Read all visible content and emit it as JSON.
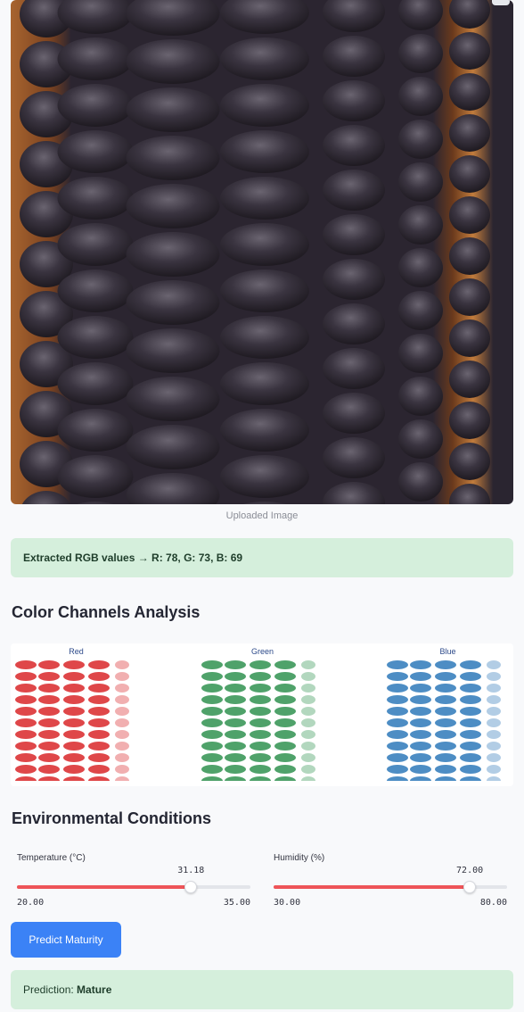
{
  "image": {
    "caption": "Uploaded Image",
    "description_icon": "corn-photo"
  },
  "rgb_alert": {
    "prefix": "Extracted RGB values → R: 78, G: 73, B: 69",
    "r": 78,
    "g": 73,
    "b": 69
  },
  "channels_section": {
    "title": "Color Channels Analysis",
    "channels": [
      {
        "label": "Red",
        "color": "#d7191c"
      },
      {
        "label": "Green",
        "color": "#238b45"
      },
      {
        "label": "Blue",
        "color": "#2171b5"
      }
    ]
  },
  "env_section": {
    "title": "Environmental Conditions",
    "sliders": [
      {
        "label": "Temperature (°C)",
        "value": "31.18",
        "min": "20.00",
        "max": "35.00",
        "fraction": 0.7453
      },
      {
        "label": "Humidity (%)",
        "value": "72.00",
        "min": "30.00",
        "max": "80.00",
        "fraction": 0.84
      }
    ]
  },
  "predict_button": {
    "label": "Predict Maturity"
  },
  "prediction": {
    "prefix": "Prediction: ",
    "value": "Mature"
  },
  "colors": {
    "success_bg": "#d5efdc",
    "slider_fill": "#ee5458",
    "primary_button": "#3b82f6"
  }
}
